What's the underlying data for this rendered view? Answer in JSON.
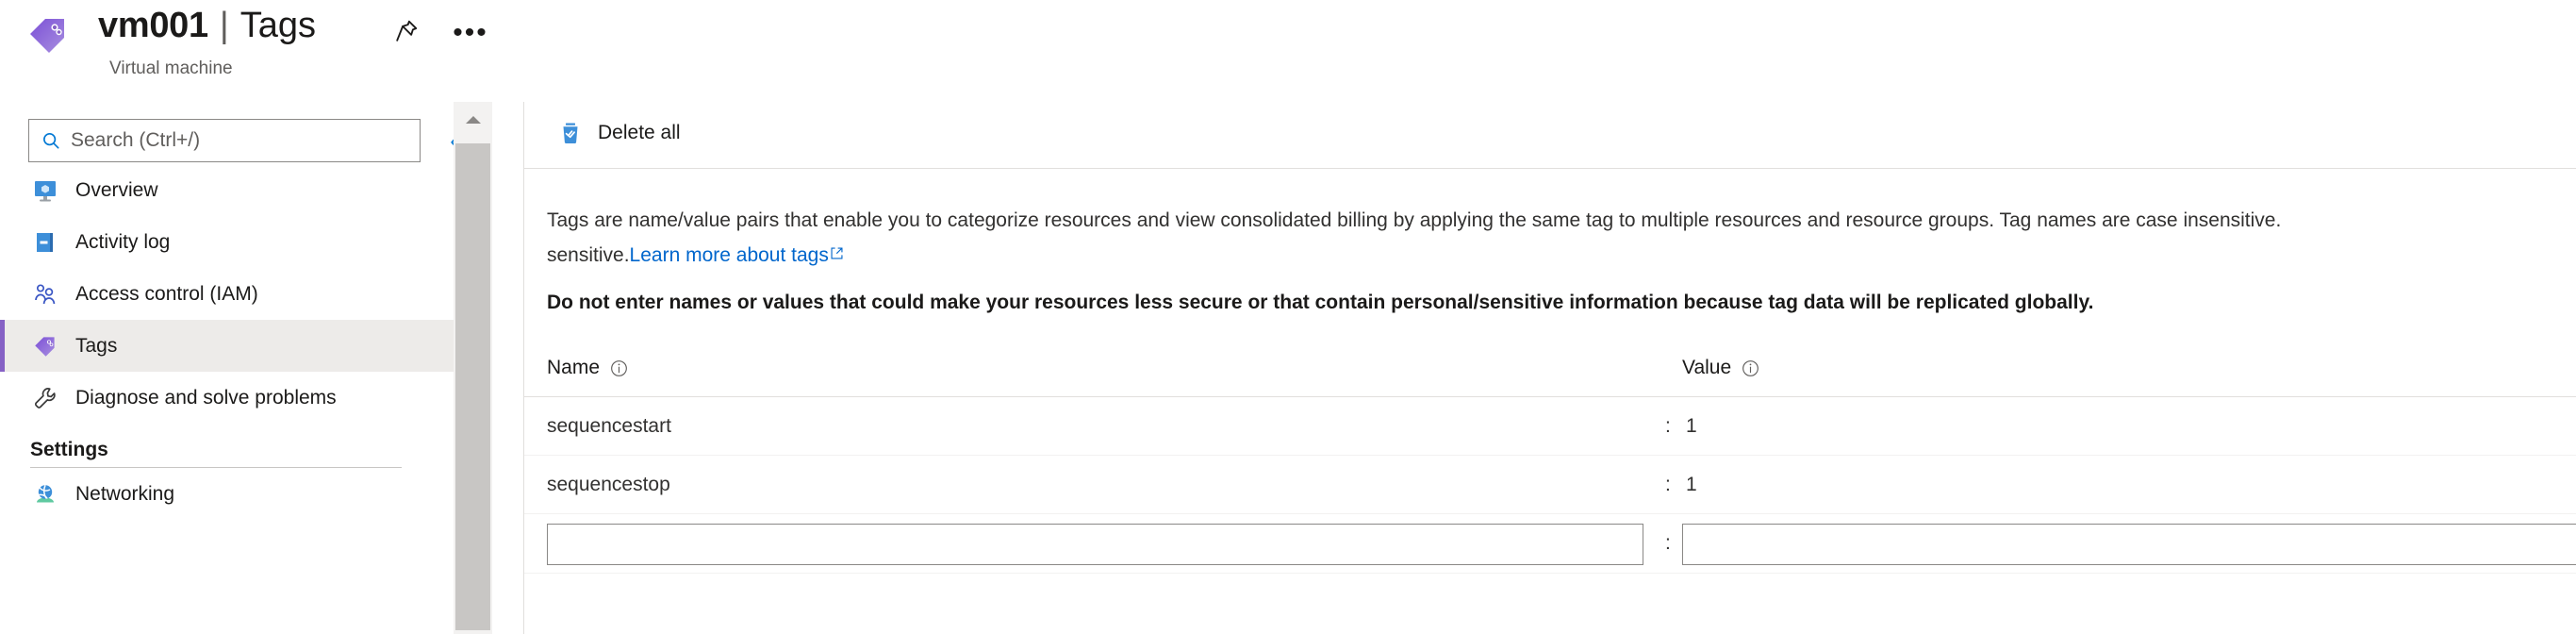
{
  "header": {
    "resource_icon": "tag-icon",
    "resource_name": "vm001",
    "separator": "|",
    "blade_name": "Tags",
    "subtitle": "Virtual machine",
    "pin_icon": "pin-icon",
    "more_icon": "ellipsis-icon",
    "more_glyph": "•••"
  },
  "sidebar": {
    "search": {
      "placeholder": "Search (Ctrl+/)",
      "value": "",
      "icon": "search-icon"
    },
    "collapse": {
      "icon": "chevron-double-left-icon",
      "glyph": "«"
    },
    "items": [
      {
        "label": "Overview",
        "icon": "overview-monitor-icon",
        "selected": false
      },
      {
        "label": "Activity log",
        "icon": "activity-log-icon",
        "selected": false
      },
      {
        "label": "Access control (IAM)",
        "icon": "access-control-people-icon",
        "selected": false
      },
      {
        "label": "Tags",
        "icon": "tag-icon",
        "selected": true
      },
      {
        "label": "Diagnose and solve problems",
        "icon": "wrench-icon",
        "selected": false
      }
    ],
    "group": {
      "title": "Settings"
    },
    "group_items": [
      {
        "label": "Networking",
        "icon": "networking-globe-icon",
        "selected": false
      }
    ],
    "scrollbar": {
      "up_icon": "scroll-up-arrow-icon"
    }
  },
  "toolbar": {
    "delete_all_label": "Delete all",
    "delete_all_icon": "delete-all-trash-icon"
  },
  "main": {
    "description_line1": "Tags are name/value pairs that enable you to categorize resources and view consolidated billing by applying the same tag to multiple resources and resource groups. Tag names are case insensitive.",
    "description_prefix2": "sensitive.",
    "learn_more_label": "Learn more about tags",
    "learn_more_icon": "external-link-icon",
    "warning": "Do not enter names or values that could make your resources less secure or that contain personal/sensitive information because tag data will be replicated globally.",
    "columns": {
      "name": "Name",
      "value": "Value",
      "name_info_icon": "info-icon",
      "value_info_icon": "info-icon"
    },
    "separator": ":",
    "rows": [
      {
        "name": "sequencestart",
        "value": "1"
      },
      {
        "name": "sequencestop",
        "value": "1"
      }
    ],
    "new_row": {
      "name_value": "",
      "name_placeholder": "",
      "value_value": "",
      "value_placeholder": ""
    }
  },
  "colors": {
    "accent_purple": "#8661c5",
    "accent_blue": "#0078d4",
    "link_blue": "#0066cc",
    "selected_bg": "#edebe9",
    "border": "#e1dfdd"
  }
}
